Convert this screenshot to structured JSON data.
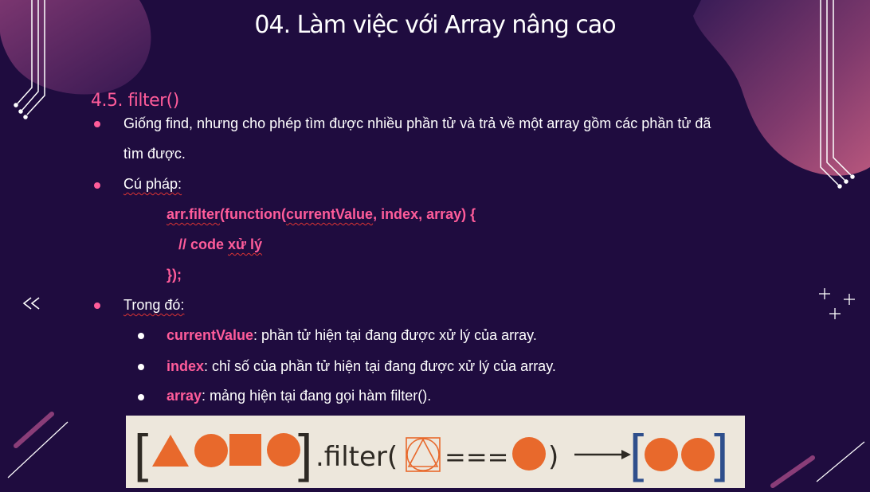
{
  "slide": {
    "title": "04. Làm việc với Array nâng cao",
    "section": "4.5. filter()",
    "bullets": {
      "desc_line1": "Giống find, nhưng cho phép tìm được nhiều phần tử và trả về một array gồm các phần tử đã",
      "desc_line2": "tìm được.",
      "syntax_label": "Cú pháp:",
      "where_label": "Trong đó:"
    },
    "code": {
      "line1_a": "arr.filter",
      "line1_b": "(function(",
      "line1_c": "currentValue",
      "line1_d": ", index, array) {",
      "line2_a": "// code ",
      "line2_b": "xử lý",
      "line3": "});"
    },
    "params": [
      {
        "name": "currentValue",
        "desc": ": phần tử hiện tại đang được xử lý của array."
      },
      {
        "name": "index",
        "desc": ": chỉ số của phần tử hiện tại đang được xử lý của array."
      },
      {
        "name": "array",
        "desc": ": mảng hiện tại đang gọi hàm filter()."
      }
    ],
    "banner": {
      "open_bracket": "[",
      "close_bracket": "]",
      "method": ".filter(",
      "operator": "===",
      "close_paren": ")",
      "colors": {
        "shape": "#e8692c",
        "bracket_left": "#2e2a24",
        "bracket_right": "#2f4f8c"
      }
    },
    "icons": {
      "prev": "double-left-arrow-icon",
      "sparkle": "plus-sparkle-icon"
    },
    "colors": {
      "accent": "#ff5c9a",
      "background": "#1f0c3f",
      "text": "#ffffff"
    }
  }
}
